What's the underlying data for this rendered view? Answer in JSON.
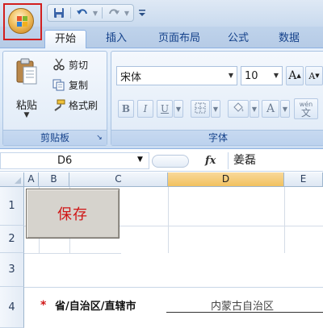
{
  "quick_access": {
    "save_icon": "floppy-disk-icon",
    "undo_icon": "undo-arrow-icon",
    "redo_icon": "redo-arrow-icon",
    "customize_icon": "customize-dropdown-icon"
  },
  "tabs": [
    {
      "label": "开始",
      "active": true
    },
    {
      "label": "插入",
      "active": false
    },
    {
      "label": "页面布局",
      "active": false
    },
    {
      "label": "公式",
      "active": false
    },
    {
      "label": "数据",
      "active": false
    }
  ],
  "clipboard": {
    "paste_label": "粘贴",
    "cut_label": "剪切",
    "copy_label": "复制",
    "format_painter_label": "格式刷",
    "group_label": "剪贴板"
  },
  "font": {
    "font_name": "宋体",
    "font_size": "10",
    "bold": "B",
    "italic": "I",
    "underline": "U",
    "font_color_letter": "A",
    "grow_font": "A",
    "shrink_font": "A",
    "wen_label": "wén",
    "wen_char": "文",
    "group_label": "字体"
  },
  "formula_bar": {
    "name_box": "D6",
    "fx_label": "fx",
    "formula_value": "姜磊"
  },
  "sheet": {
    "columns": [
      "A",
      "B",
      "C",
      "D",
      "E"
    ],
    "active_column": "D",
    "rows": [
      "1",
      "2",
      "3",
      "4"
    ],
    "save_button_label": "保存",
    "required_marker": "*",
    "field_label": "省/自治区/直辖市",
    "field_value": "内蒙古自治区"
  },
  "colors": {
    "accent_red": "#d01616",
    "ribbon_blue": "#15428b",
    "active_column_header": "#f1c15f"
  }
}
